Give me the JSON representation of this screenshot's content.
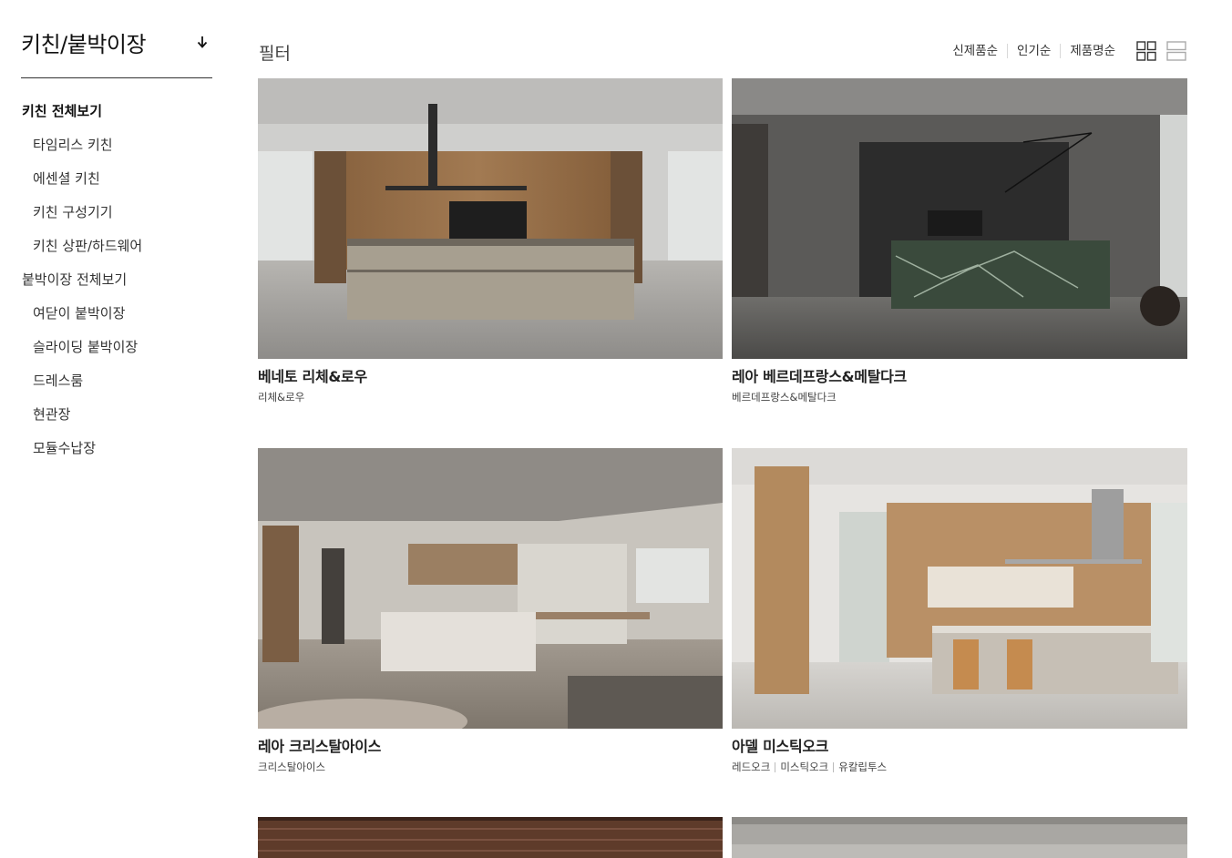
{
  "sidebar": {
    "category_title": "키친/붙박이장",
    "menu": [
      {
        "label": "키친 전체보기",
        "type": "group",
        "active": true
      },
      {
        "label": "타임리스 키친",
        "type": "sub"
      },
      {
        "label": "에센셜 키친",
        "type": "sub"
      },
      {
        "label": "키친 구성기기",
        "type": "sub"
      },
      {
        "label": "키친 상판/하드웨어",
        "type": "sub"
      },
      {
        "label": "붙박이장 전체보기",
        "type": "group"
      },
      {
        "label": "여닫이 붙박이장",
        "type": "sub"
      },
      {
        "label": "슬라이딩 붙박이장",
        "type": "sub"
      },
      {
        "label": "드레스룸",
        "type": "sub"
      },
      {
        "label": "현관장",
        "type": "sub"
      },
      {
        "label": "모듈수납장",
        "type": "sub"
      }
    ]
  },
  "toolbar": {
    "filter_label": "필터",
    "sort_options": [
      "신제품순",
      "인기순",
      "제품명순"
    ],
    "view_icons": [
      "grid-view-icon",
      "list-view-icon"
    ]
  },
  "products": [
    {
      "name": "베네토 리체&로우",
      "tags": [
        "리체&로우"
      ],
      "image_icon": "kitchen-photo-icon"
    },
    {
      "name": "레아 베르데프랑스&메탈다크",
      "tags": [
        "베르데프랑스&메탈다크"
      ],
      "image_icon": "kitchen-photo-icon"
    },
    {
      "name": "레아 크리스탈아이스",
      "tags": [
        "크리스탈아이스"
      ],
      "image_icon": "kitchen-photo-icon"
    },
    {
      "name": "아델 미스틱오크",
      "tags": [
        "레드오크",
        "미스틱오크",
        "유칼립투스"
      ],
      "image_icon": "kitchen-photo-icon"
    }
  ],
  "colors": {
    "text": "#222222",
    "divider": "#333333",
    "muted": "#444444"
  }
}
